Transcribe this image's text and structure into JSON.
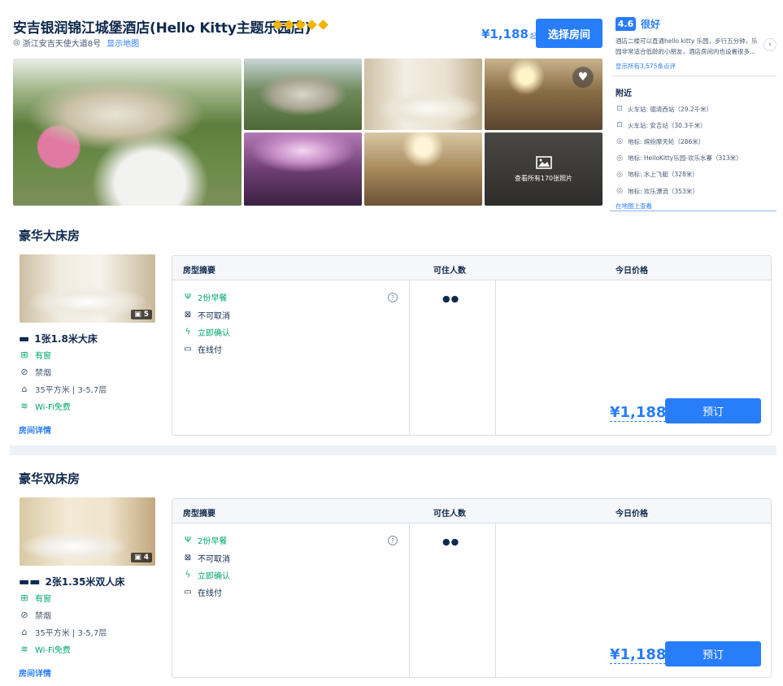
{
  "hotel": {
    "name": "安吉银润锦江城堡酒店(Hello Kitty主题乐园店)",
    "address": "浙江安吉天使大道8号",
    "map_link": "显示地图",
    "price": "¥1,188",
    "price_suffix": "起",
    "select_button": "选择房间",
    "more_photos": "查看所有170张照片"
  },
  "rating": {
    "score": "4.6",
    "label": "很好",
    "review": "酒店二楼可以直通hello kitty 乐园，步行五分钟，乐园非常适合低龄的小朋友，酒店房间内也设置很多...",
    "all_reviews": "显示所有3,575条点评"
  },
  "nearby": {
    "title": "附近",
    "items": [
      {
        "icon": "train-icon",
        "text": "火车站: 德清西站（29.2千米）"
      },
      {
        "icon": "train-icon",
        "text": "火车站: 安吉站（30.3千米）"
      },
      {
        "icon": "landmark-icon",
        "text": "地标: 缤纷摩天轮（286米）"
      },
      {
        "icon": "landmark-icon",
        "text": "地标: HelloKitty乐园-欢乐水寨（313米）"
      },
      {
        "icon": "landmark-icon",
        "text": "地标: 水上飞艇（328米）"
      },
      {
        "icon": "landmark-icon",
        "text": "地标: 欢乐漂流（353米）"
      }
    ],
    "map_view": "在地图上查看"
  },
  "table_headers": {
    "summary": "房型摘要",
    "guests": "可住人数",
    "price": "今日价格"
  },
  "rooms": [
    {
      "name": "豪华大床房",
      "photo_count": "5",
      "bed": "1张1.8米大床",
      "window": "有窗",
      "smoking": "禁烟",
      "size": "35平方米 | 3-5,7层",
      "wifi": "Wi-Fi免费",
      "details": "房间详情",
      "features": [
        "2份早餐",
        "不可取消",
        "立即确认",
        "在线付"
      ],
      "price": "¥1,188",
      "book": "预订"
    },
    {
      "name": "豪华双床房",
      "photo_count": "4",
      "bed": "2张1.35米双人床",
      "window": "有窗",
      "smoking": "禁烟",
      "size": "35平方米 | 3-5,7层",
      "wifi": "Wi-Fi免费",
      "details": "房间详情",
      "features": [
        "2份早餐",
        "不可取消",
        "立即确认",
        "在线付"
      ],
      "price": "¥1,188",
      "book": "预订"
    }
  ],
  "colors": {
    "accent": "#287dfa",
    "text": "#0f294d",
    "green": "#00a56c",
    "star": "#f4b400"
  }
}
